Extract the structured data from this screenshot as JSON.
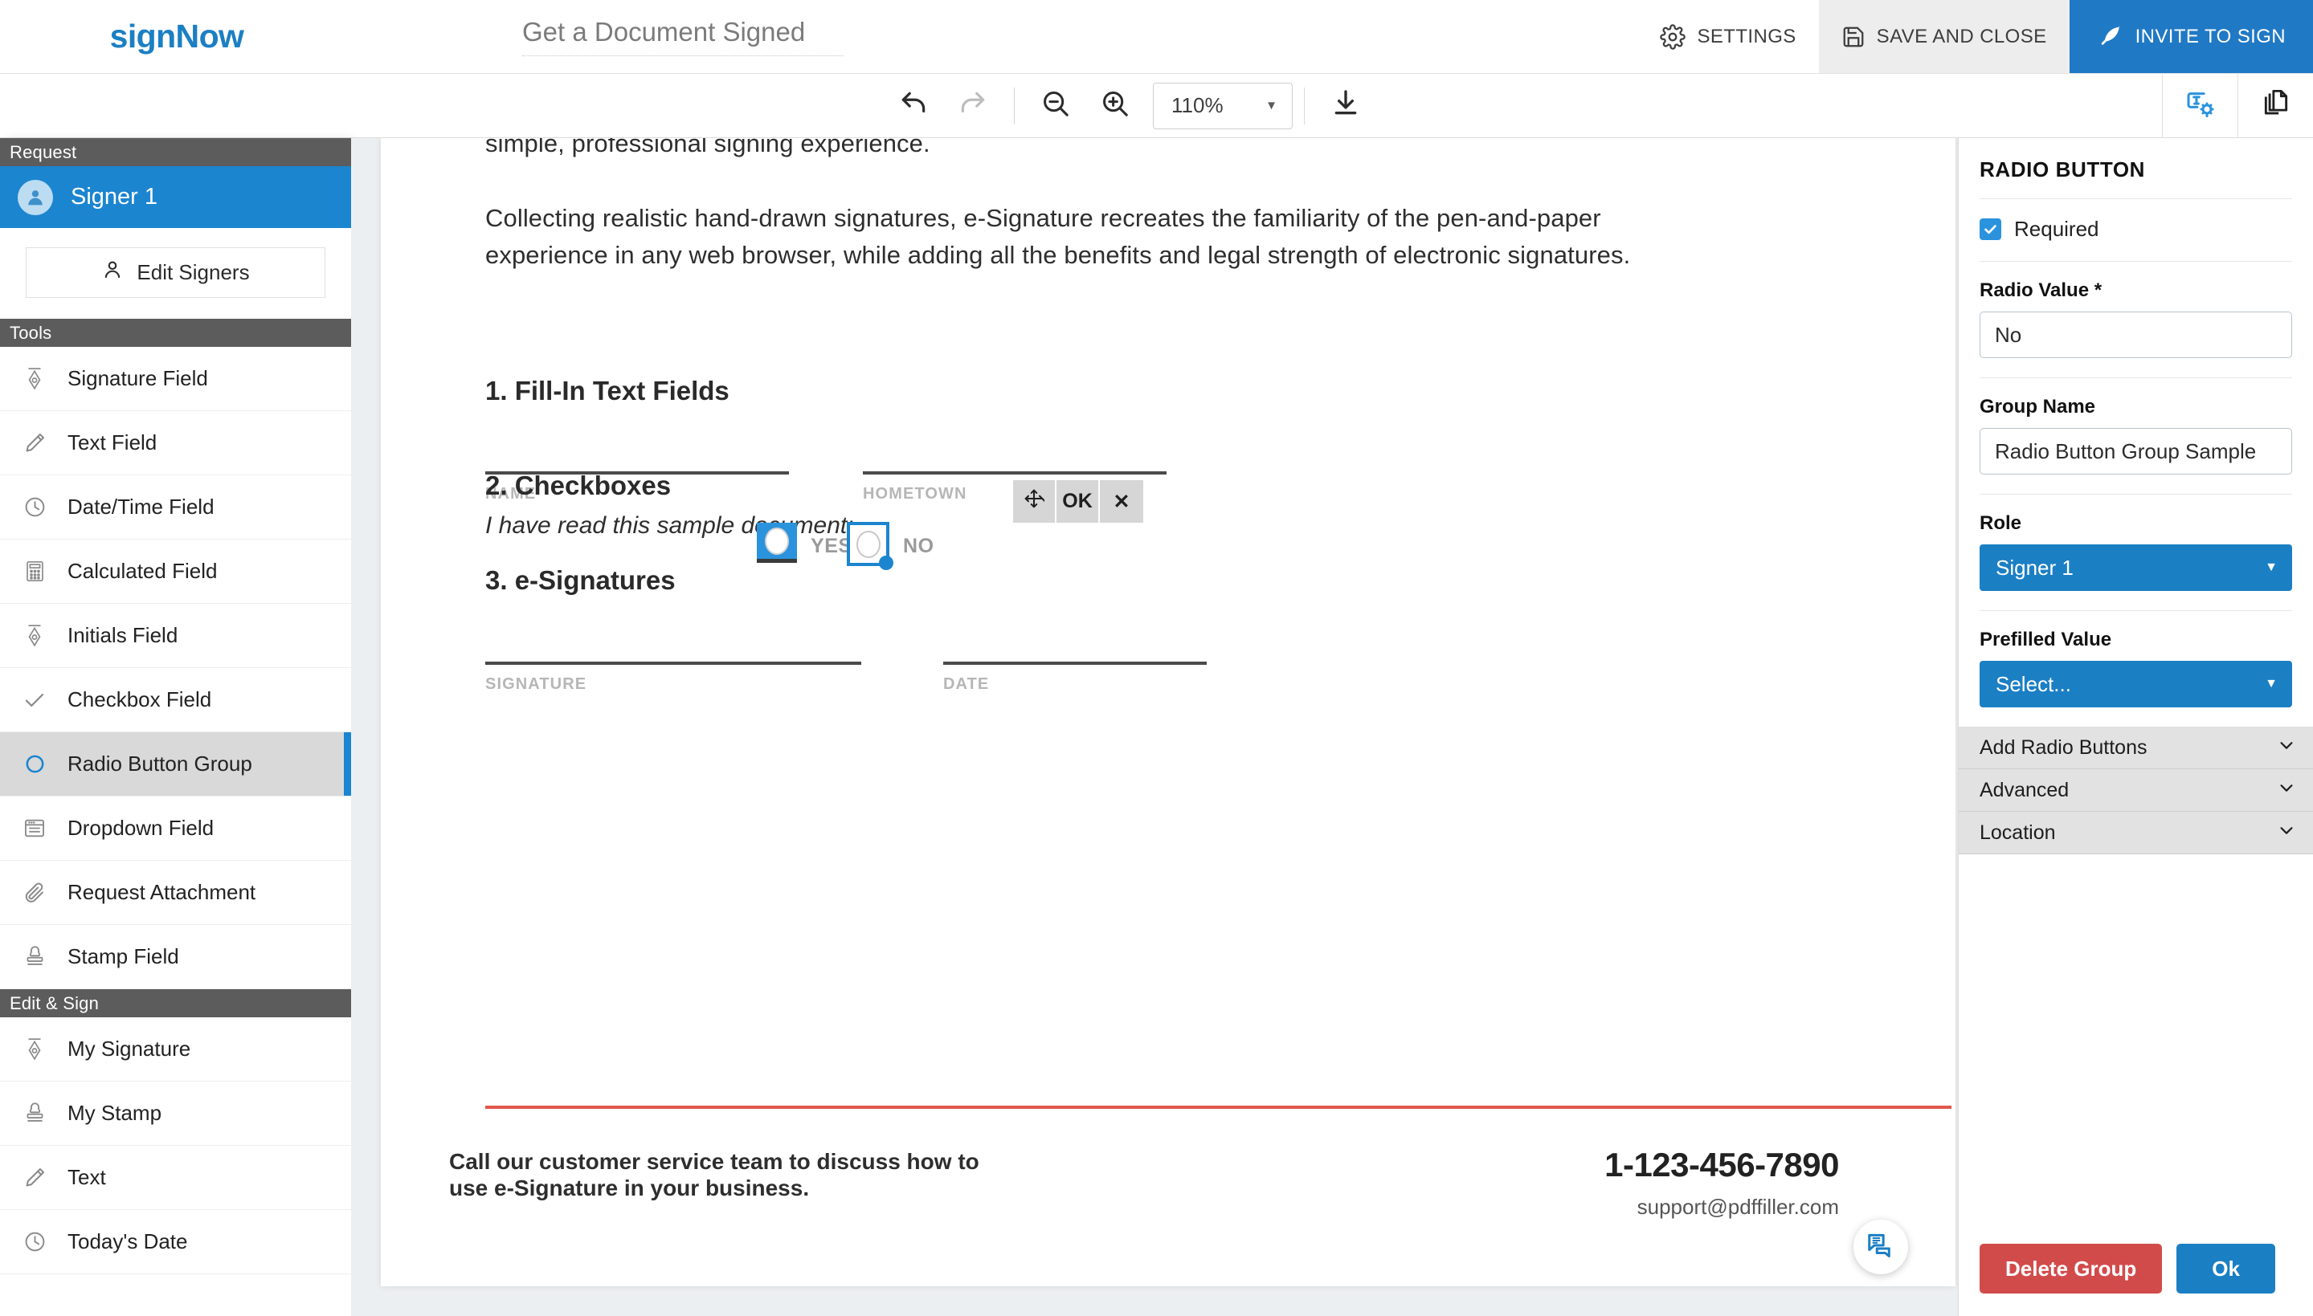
{
  "header": {
    "brand": "signNow",
    "document_title": "Get a Document Signed",
    "settings_label": "SETTINGS",
    "save_close_label": "SAVE AND CLOSE",
    "invite_label": "INVITE TO SIGN"
  },
  "toolbar": {
    "undo": "undo-icon",
    "redo": "redo-icon",
    "zoom_out": "zoom-out-icon",
    "zoom_in": "zoom-in-icon",
    "zoom_value": "110%",
    "download": "download-icon",
    "field_settings": "field-settings-icon",
    "pages": "pages-icon"
  },
  "sidebar": {
    "request_header": "Request",
    "signer": "Signer 1",
    "edit_signers_label": "Edit Signers",
    "tools_header": "Tools",
    "tools": [
      {
        "label": "Signature Field",
        "icon": "pen-nib-icon",
        "active": false
      },
      {
        "label": "Text Field",
        "icon": "pencil-icon",
        "active": false
      },
      {
        "label": "Date/Time Field",
        "icon": "clock-icon",
        "active": false
      },
      {
        "label": "Calculated Field",
        "icon": "calculator-icon",
        "active": false
      },
      {
        "label": "Initials Field",
        "icon": "pen-nib-icon",
        "active": false
      },
      {
        "label": "Checkbox Field",
        "icon": "check-icon",
        "active": false
      },
      {
        "label": "Radio Button Group",
        "icon": "radio-circle-icon",
        "active": true
      },
      {
        "label": "Dropdown Field",
        "icon": "dropdown-icon",
        "active": false
      },
      {
        "label": "Request Attachment",
        "icon": "paperclip-icon",
        "active": false
      },
      {
        "label": "Stamp Field",
        "icon": "stamp-icon",
        "active": false
      }
    ],
    "edit_sign_header": "Edit & Sign",
    "edit_sign_tools": [
      {
        "label": "My Signature",
        "icon": "pen-nib-icon"
      },
      {
        "label": "My Stamp",
        "icon": "stamp-icon"
      },
      {
        "label": "Text",
        "icon": "pencil-icon"
      },
      {
        "label": "Today's Date",
        "icon": "clock-icon"
      }
    ]
  },
  "document": {
    "paragraph_1": "simple, professional signing experience.",
    "paragraph_2": "Collecting realistic hand-drawn signatures, e-Signature recreates the familiarity of the pen-and-paper experience in any web browser, while adding all the benefits and legal strength of electronic signatures.",
    "section_1_title": "1. Fill-In Text Fields",
    "label_name": "NAME",
    "label_hometown": "HOMETOWN",
    "section_2_title": "2. Checkboxes",
    "checkbox_question": "I have read this sample document:",
    "option_yes": "YES",
    "option_no": "NO",
    "section_3_title": "3. e-Signatures",
    "label_signature": "SIGNATURE",
    "label_date": "DATE",
    "footer_line_1": "Call our customer service team to discuss how to",
    "footer_line_2": "use e-Signature in your business.",
    "footer_phone": "1-123-456-7890",
    "footer_email": "support@pdffiller.com"
  },
  "field_toolbar": {
    "move_label": "move-icon",
    "ok_label": "OK",
    "close_label": "✕"
  },
  "properties": {
    "title": "RADIO BUTTON",
    "required_label": "Required",
    "required_checked": true,
    "radio_value_label": "Radio Value *",
    "radio_value": "No",
    "group_name_label": "Group Name",
    "group_name": "Radio Button Group Sample",
    "role_label": "Role",
    "role_value": "Signer 1",
    "prefilled_label": "Prefilled Value",
    "prefilled_value": "Select...",
    "accordions": [
      "Add Radio Buttons",
      "Advanced",
      "Location"
    ],
    "delete_label": "Delete Group",
    "ok_label": "Ok"
  },
  "colors": {
    "brand_blue": "#1b7fc4",
    "signer_blue": "#1b85d0",
    "danger_red": "#d24b4b",
    "footer_rule": "#e2574c",
    "sidebar_header": "#5c5c5c"
  }
}
